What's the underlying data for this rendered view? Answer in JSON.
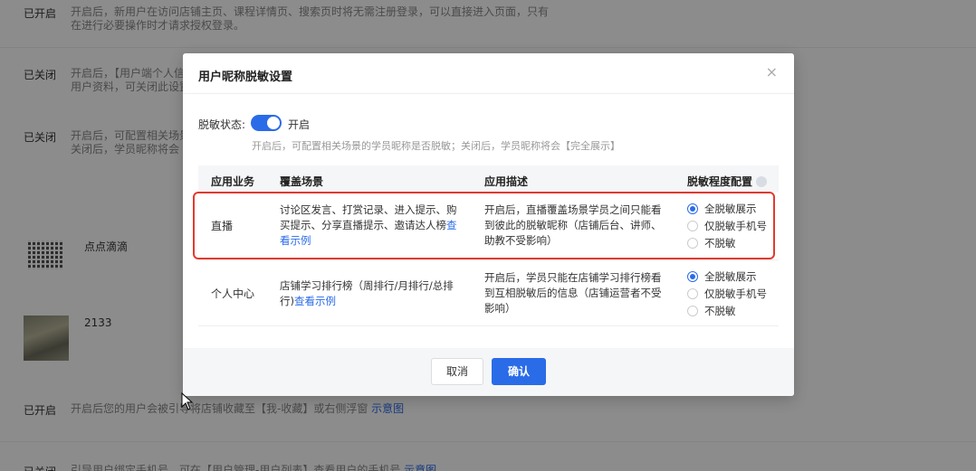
{
  "background": {
    "rows": [
      {
        "status": "已开启",
        "desc_line1": "开启后，新用户在访问店铺主页、课程详情页、搜索页时将无需注册登录，可以直接进入页面，只有",
        "desc_line2": "在进行必要操作时才请求授权登录。"
      },
      {
        "status": "已关闭",
        "desc_line1": "开启后，【用户端个人信",
        "desc_line2": "用户资料，可关闭此设置"
      },
      {
        "status": "已关闭",
        "desc_line1": "开启后，可配置相关场景",
        "desc_line2": "关闭后，学员昵称将会"
      },
      {
        "status": "已开启",
        "desc_line1": "开启后您的用户会被引导将店铺收藏至【我-收藏】或右侧浮窗",
        "link": "示意图"
      },
      {
        "status": "已关闭",
        "desc_line1": "引导用户绑定手机号，可在【用户管理-用户列表】查看用户的手机号",
        "link": "示意图"
      }
    ],
    "qr_name": "点点滴滴",
    "photo_name": "2133"
  },
  "modal": {
    "title": "用户昵称脱敏设置",
    "close_icon": "×",
    "status_label": "脱敏状态:",
    "status_value": "开启",
    "toggle_on": true,
    "status_hint": "开启后，可配置相关场景的学员昵称是否脱敏；关闭后，学员昵称将会【完全展示】",
    "table": {
      "headers": {
        "business": "应用业务",
        "scene": "覆盖场景",
        "desc": "应用描述",
        "level": "脱敏程度配置"
      },
      "rows": [
        {
          "business": "直播",
          "scene": "讨论区发言、打赏记录、进入提示、购买提示、分享直播提示、邀请达人榜",
          "scene_link": "查看示例",
          "desc": "开启后，直播覆盖场景学员之间只能看到彼此的脱敏昵称（店铺后台、讲师、助教不受影响）",
          "options": [
            "全脱敏展示",
            "仅脱敏手机号",
            "不脱敏"
          ],
          "selected": 0
        },
        {
          "business": "个人中心",
          "scene": "店铺学习排行榜（周排行/月排行/总排行)",
          "scene_link": "查看示例",
          "desc": "开启后，学员只能在店铺学习排行榜看到互相脱敏后的信息（店铺运营者不受影响）",
          "options": [
            "全脱敏展示",
            "仅脱敏手机号",
            "不脱敏"
          ],
          "selected": 0
        }
      ]
    },
    "cancel_label": "取消",
    "confirm_label": "确认"
  },
  "colors": {
    "accent": "#2a6be8",
    "highlight": "#e23a2e"
  }
}
